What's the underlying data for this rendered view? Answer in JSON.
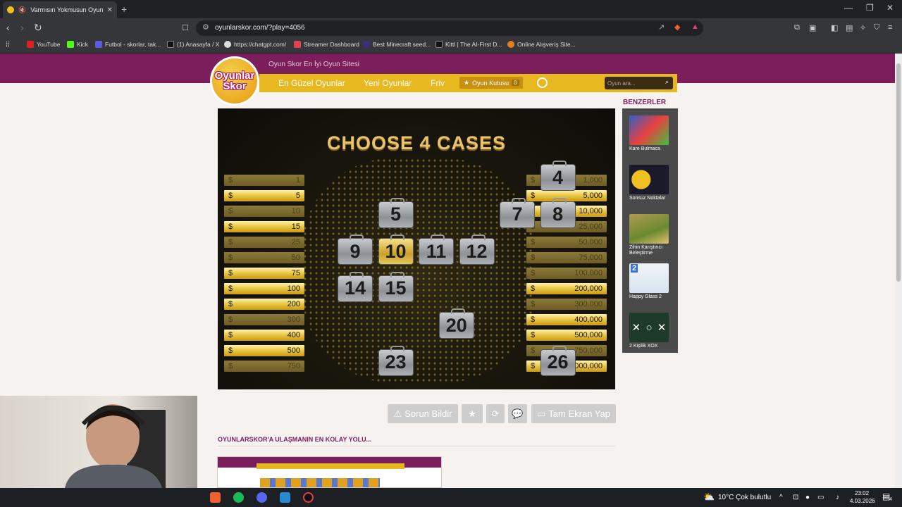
{
  "browser": {
    "tab_title": "Varmısın Yokmusun Oyunu O...",
    "url": "oyunlarskor.com/?play=4056",
    "bookmarks": [
      "YouTube",
      "Kick",
      "Futbol - skorlar, tak...",
      "(1) Anasayfa / X",
      "https://chatgpt.com/",
      "Streamer Dashboard",
      "Best Minecraft seed...",
      "Kittl | The AI-First D...",
      "Online Alışveriş Site..."
    ]
  },
  "site": {
    "logo_top": "Oyunlar",
    "logo_bottom": "Skor",
    "tagline": "Oyun Skor En İyi Oyun Sitesi",
    "menu": [
      "En Güzel Oyunlar",
      "Yeni Oyunlar",
      "Friv"
    ],
    "kutusu_label": "Oyun Kutusu",
    "kutusu_count": "0",
    "search_placeholder": "Oyun ara..."
  },
  "game": {
    "title": "CHOOSE 4 CASES",
    "currency": "$",
    "left_values": [
      "1",
      "5",
      "10",
      "15",
      "25",
      "50",
      "75",
      "100",
      "200",
      "300",
      "400",
      "500",
      "750"
    ],
    "left_on": [
      false,
      true,
      false,
      true,
      false,
      false,
      true,
      true,
      true,
      false,
      true,
      true,
      false
    ],
    "right_values": [
      "1,000",
      "5,000",
      "10,000",
      "25,000",
      "50,000",
      "75,000",
      "100,000",
      "200,000",
      "300,000",
      "400,000",
      "500,000",
      "750,000",
      "1,000,000"
    ],
    "right_on": [
      false,
      true,
      true,
      false,
      false,
      false,
      false,
      true,
      false,
      true,
      true,
      false,
      true
    ],
    "cases": [
      {
        "n": "4",
        "c": 7,
        "r": 0
      },
      {
        "n": "5",
        "c": 3,
        "r": 1
      },
      {
        "n": "7",
        "c": 6,
        "r": 1
      },
      {
        "n": "8",
        "c": 7,
        "r": 1
      },
      {
        "n": "9",
        "c": 2,
        "r": 2
      },
      {
        "n": "10",
        "c": 3,
        "r": 2,
        "sel": true
      },
      {
        "n": "11",
        "c": 4,
        "r": 2
      },
      {
        "n": "12",
        "c": 5,
        "r": 2
      },
      {
        "n": "14",
        "c": 2,
        "r": 3
      },
      {
        "n": "15",
        "c": 3,
        "r": 3
      },
      {
        "n": "20",
        "c": 4.5,
        "r": 4
      },
      {
        "n": "23",
        "c": 3,
        "r": 5
      },
      {
        "n": "26",
        "c": 7,
        "r": 5
      }
    ]
  },
  "sidebar": {
    "title": "BENZERLER",
    "items": [
      {
        "label": "Kare Bulmaca",
        "color": "#3060c8"
      },
      {
        "label": "Sonsuz Noktalar",
        "color": "#e8b820"
      },
      {
        "label": "Zihin Karıştırıcı Birleştirme",
        "color": "#8a9a40"
      },
      {
        "label": "Happy Glass 2",
        "color": "#f0f4f8"
      },
      {
        "label": "2 Kişilik XOX",
        "color": "#1e3a2a"
      }
    ]
  },
  "tools": {
    "report": "Sorun Bildir",
    "fullscreen": "Tam Ekran Yap"
  },
  "section": {
    "title": "OYUNLARSKOR'A ULAŞMANIN EN KOLAY YOLU..."
  },
  "taskbar": {
    "weather": "10°C  Çok bulutlu",
    "time": "23:02",
    "date": "4.03.2026",
    "notif": "4"
  }
}
